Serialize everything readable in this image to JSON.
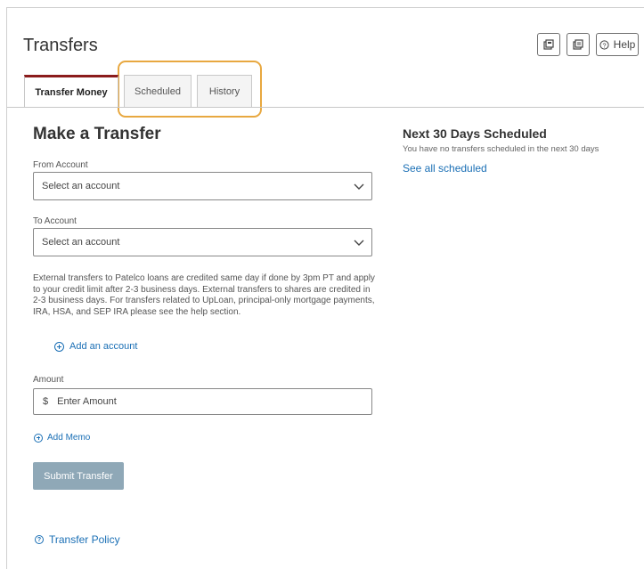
{
  "page": {
    "title": "Transfers"
  },
  "header": {
    "help_label": "Help"
  },
  "tabs": [
    {
      "label": "Transfer Money",
      "active": true
    },
    {
      "label": "Scheduled",
      "active": false
    },
    {
      "label": "History",
      "active": false
    }
  ],
  "form": {
    "title": "Make a Transfer",
    "from_label": "From Account",
    "from_value": "Select an account",
    "to_label": "To Account",
    "to_value": "Select an account",
    "info": "External transfers to Patelco loans are credited same day if done by 3pm PT and apply to your credit limit after 2-3 business days. External transfers to shares are credited in 2-3 business days. For transfers related to UpLoan, principal-only mortgage payments, IRA, HSA, and SEP IRA please see the help section.",
    "add_account": "Add an account",
    "amount_label": "Amount",
    "currency_symbol": "$",
    "amount_placeholder": "Enter Amount",
    "add_memo": "Add Memo",
    "submit_label": "Submit Transfer",
    "policy_link": "Transfer Policy"
  },
  "scheduled": {
    "title_bold": "Next 30",
    "title_rest": " Days Scheduled",
    "empty_message": "You have no transfers scheduled in the next 30 days",
    "see_all": "See all scheduled"
  },
  "colors": {
    "accent_tab": "#8b1c1c",
    "link": "#1a6fb5",
    "highlight": "#e8a840",
    "submit_disabled": "#8fa8b7"
  }
}
